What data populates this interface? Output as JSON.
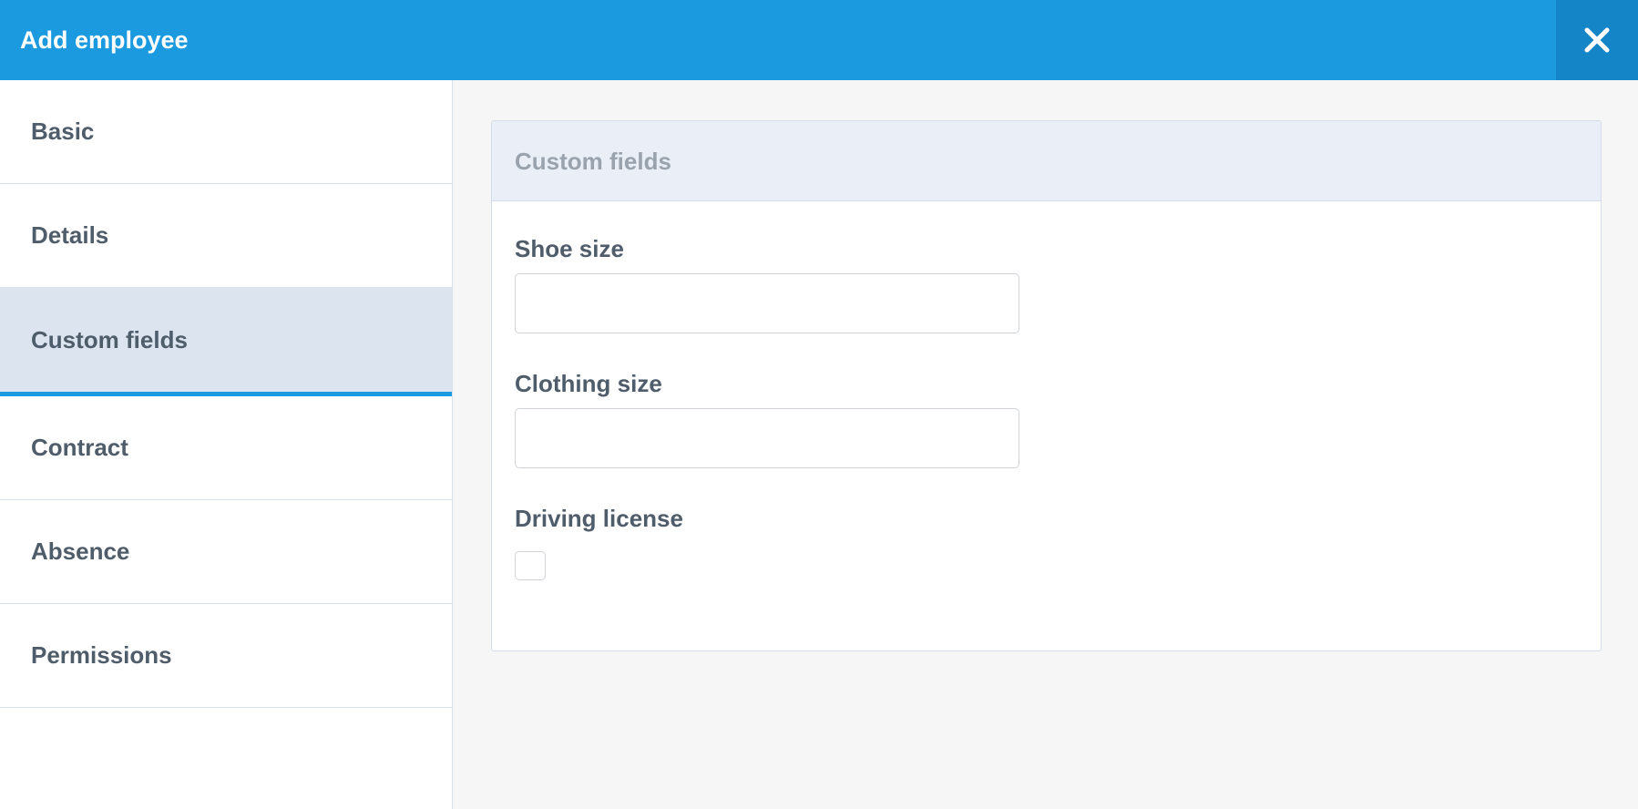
{
  "header": {
    "title": "Add employee",
    "close_icon": "close-icon",
    "background_color": "#1b9ae0"
  },
  "sidebar": {
    "items": [
      {
        "label": "Basic",
        "active": false
      },
      {
        "label": "Details",
        "active": false
      },
      {
        "label": "Custom fields",
        "active": true
      },
      {
        "label": "Contract",
        "active": false
      },
      {
        "label": "Absence",
        "active": false
      },
      {
        "label": "Permissions",
        "active": false
      }
    ],
    "active_indicator_color": "#1b9ae0"
  },
  "panel": {
    "title": "Custom fields",
    "fields": {
      "shoe_size": {
        "label": "Shoe size",
        "value": "",
        "placeholder": ""
      },
      "clothing_size": {
        "label": "Clothing size",
        "value": "",
        "placeholder": ""
      },
      "driving_license": {
        "label": "Driving license",
        "checked": false
      }
    }
  }
}
